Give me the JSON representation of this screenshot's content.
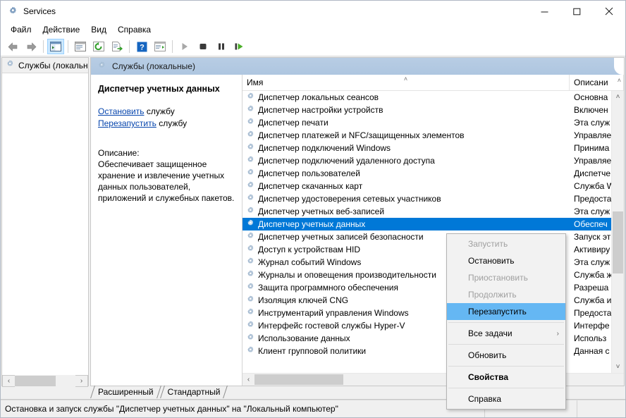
{
  "window": {
    "title": "Services",
    "icon": "services-gear-icon",
    "minimize_label": "—",
    "maximize_label": "□",
    "close_label": "✕"
  },
  "menubar": {
    "items": [
      {
        "label": "Файл",
        "name": "menu-file"
      },
      {
        "label": "Действие",
        "name": "menu-action"
      },
      {
        "label": "Вид",
        "name": "menu-view"
      },
      {
        "label": "Справка",
        "name": "menu-help"
      }
    ]
  },
  "toolbar": {
    "buttons": [
      {
        "name": "back-icon",
        "glyph": "back-arrow"
      },
      {
        "name": "forward-icon",
        "glyph": "forward-arrow"
      },
      {
        "name": "show-hide-console-tree-icon",
        "glyph": "console-tree",
        "pressed": true
      },
      {
        "name": "show-hide-action-pane-icon",
        "glyph": "action-pane"
      },
      {
        "name": "refresh-icon",
        "glyph": "refresh"
      },
      {
        "name": "export-list-icon",
        "glyph": "export"
      },
      {
        "name": "help-icon",
        "glyph": "help"
      },
      {
        "name": "properties-icon",
        "glyph": "properties"
      },
      {
        "name": "start-service-icon",
        "glyph": "play"
      },
      {
        "name": "stop-service-icon",
        "glyph": "stop"
      },
      {
        "name": "pause-service-icon",
        "glyph": "pause"
      },
      {
        "name": "restart-service-icon",
        "glyph": "restart"
      }
    ]
  },
  "tree": {
    "root_label": "Службы (локальные)",
    "root_icon": "services-gear-icon",
    "scroll_left_label": "‹",
    "scroll_right_label": "›"
  },
  "result": {
    "banner_label": "Службы (локальные)",
    "banner_icon": "services-gear-icon"
  },
  "details": {
    "service_name": "Диспетчер учетных данных",
    "stop_link": "Остановить",
    "stop_suffix": " службу",
    "restart_link": "Перезапустить",
    "restart_suffix": " службу",
    "description_label": "Описание:",
    "description_text": "Обеспечивает защищенное хранение и извлечение учетных данных пользователей, приложений и служебных пакетов."
  },
  "listview": {
    "columns": [
      {
        "label": "Имя",
        "name": "column-header-name",
        "sorted": true
      },
      {
        "label": "Описани",
        "name": "column-header-description",
        "sorted": false
      }
    ],
    "sort_caret": "˄",
    "desc_caret": "˄",
    "rows": [
      {
        "name": "Диспетчер локальных сеансов",
        "description": "Основна",
        "selected": false
      },
      {
        "name": "Диспетчер настройки устройств",
        "description": "Включен",
        "selected": false
      },
      {
        "name": "Диспетчер печати",
        "description": "Эта служ",
        "selected": false
      },
      {
        "name": "Диспетчер платежей и NFC/защищенных элементов",
        "description": "Управляе",
        "selected": false
      },
      {
        "name": "Диспетчер подключений Windows",
        "description": "Принима",
        "selected": false
      },
      {
        "name": "Диспетчер подключений удаленного доступа",
        "description": "Управляе",
        "selected": false
      },
      {
        "name": "Диспетчер пользователей",
        "description": "Диспетче",
        "selected": false
      },
      {
        "name": "Диспетчер скачанных карт",
        "description": "Служба W",
        "selected": false
      },
      {
        "name": "Диспетчер удостоверения сетевых участников",
        "description": "Предоста",
        "selected": false
      },
      {
        "name": "Диспетчер учетных веб-записей",
        "description": "Эта служ",
        "selected": false
      },
      {
        "name": "Диспетчер учетных данных",
        "description": "Обеспеч",
        "selected": true
      },
      {
        "name": "Диспетчер учетных записей безопасности",
        "description": "Запуск эт",
        "selected": false
      },
      {
        "name": "Доступ к устройствам HID",
        "description": "Активиру",
        "selected": false
      },
      {
        "name": "Журнал событий Windows",
        "description": "Эта служ",
        "selected": false
      },
      {
        "name": "Журналы и оповещения производительности",
        "description": "Служба ж",
        "selected": false
      },
      {
        "name": "Защита программного обеспечения",
        "description": "Разреша",
        "selected": false
      },
      {
        "name": "Изоляция ключей CNG",
        "description": "Служба и",
        "selected": false
      },
      {
        "name": "Инструментарий управления Windows",
        "description": "Предоста",
        "selected": false
      },
      {
        "name": "Интерфейс гостевой службы Hyper-V",
        "description": "Интерфе",
        "selected": false
      },
      {
        "name": "Использование данных",
        "description": "Использ",
        "selected": false
      },
      {
        "name": "Клиент групповой политики",
        "description": "Данная с",
        "selected": false
      }
    ],
    "scroll_up_label": "˄",
    "scroll_down_label": "˅",
    "scroll_left_label": "‹"
  },
  "context_menu": {
    "items": [
      {
        "label": "Запустить",
        "name": "ctx-start",
        "state": "disabled"
      },
      {
        "label": "Остановить",
        "name": "ctx-stop",
        "state": "normal"
      },
      {
        "label": "Приостановить",
        "name": "ctx-pause",
        "state": "disabled"
      },
      {
        "label": "Продолжить",
        "name": "ctx-resume",
        "state": "disabled"
      },
      {
        "label": "Перезапустить",
        "name": "ctx-restart",
        "state": "highlight"
      },
      {
        "separator": true,
        "name": "ctx-separator-1"
      },
      {
        "label": "Все задачи",
        "name": "ctx-all-tasks",
        "state": "normal",
        "submenu": true,
        "submenu_arrow": "›"
      },
      {
        "separator": true,
        "name": "ctx-separator-2"
      },
      {
        "label": "Обновить",
        "name": "ctx-refresh",
        "state": "normal"
      },
      {
        "separator": true,
        "name": "ctx-separator-3"
      },
      {
        "label": "Свойства",
        "name": "ctx-properties",
        "state": "bold"
      },
      {
        "separator": true,
        "name": "ctx-separator-4"
      },
      {
        "label": "Справка",
        "name": "ctx-help",
        "state": "normal"
      }
    ]
  },
  "tabs": [
    {
      "label": "Расширенный",
      "name": "tab-extended",
      "active": true
    },
    {
      "label": "Стандартный",
      "name": "tab-standard",
      "active": false
    }
  ],
  "statusbar": {
    "text": "Остановка и запуск службы \"Диспетчер учетных данных\" на \"Локальный компьютер\""
  },
  "colors": {
    "selection": "#0078d7",
    "menu_highlight": "#65b7f3",
    "banner": "#aec6e0",
    "link": "#0645ad",
    "toolbar_pressed": "#cce8ff"
  }
}
